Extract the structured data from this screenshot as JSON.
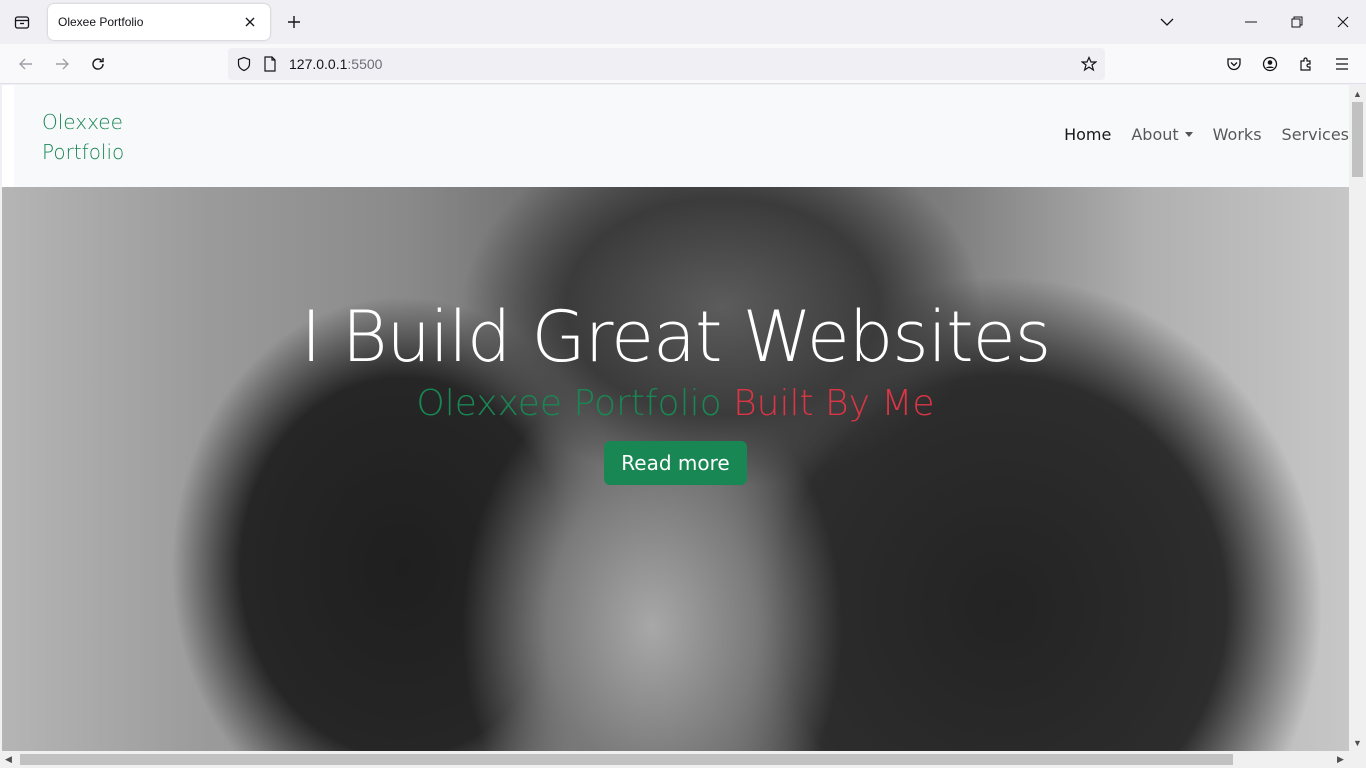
{
  "browser": {
    "tab_title": "Olexee Portfolio",
    "url_host": "127.0.0.1",
    "url_port": ":5500"
  },
  "site": {
    "brand_line1": "Olexxee",
    "brand_line2": "Portfolio",
    "nav": {
      "home": "Home",
      "about": "About",
      "works": "Works",
      "services": "Services"
    },
    "hero": {
      "title": "I Build Great Websites",
      "sub_green": "Olexxee Portfolio",
      "sub_red": "Built By Me",
      "button": "Read more"
    }
  },
  "colors": {
    "brand_green": "#198754",
    "accent_red": "#dc3545"
  }
}
